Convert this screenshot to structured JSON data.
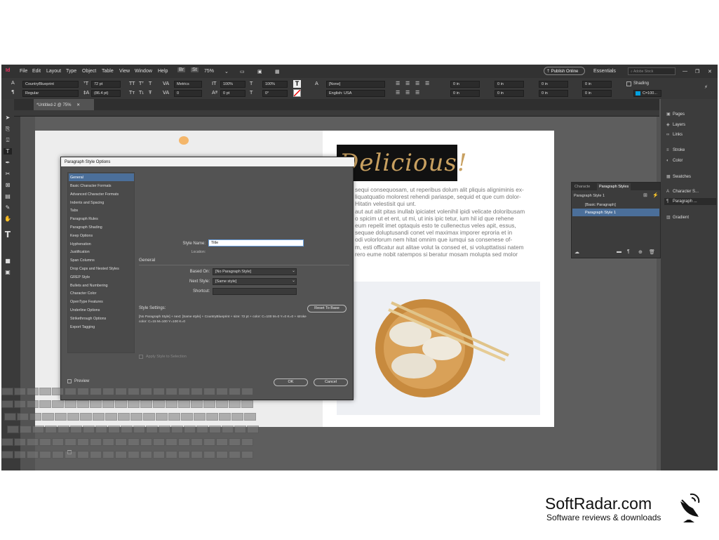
{
  "app": {
    "logo_text": "Id",
    "menu": [
      "File",
      "Edit",
      "Layout",
      "Type",
      "Object",
      "Table",
      "View",
      "Window",
      "Help"
    ],
    "bridge": "Br",
    "stock": "St",
    "zoom": "75%",
    "publish_label": "Publish Online",
    "workspace": "Essentials",
    "search_placeholder": "Adobe Stock"
  },
  "control_panel": {
    "font_family": "CountryBlueprint",
    "font_style": "Regular",
    "font_size": "72 pt",
    "leading": "(86.4 pt)",
    "kerning": "Metrics",
    "tracking": "0",
    "v_scale": "100%",
    "h_scale": "100%",
    "baseline": "0 pt",
    "skew": "0°",
    "char_style": "[None]",
    "language": "English: USA",
    "indent_values": [
      "0 in",
      "0 in",
      "0 in",
      "0 in",
      "0 in",
      "0 in",
      "0 in",
      "0 in"
    ],
    "shading_label": "Shading",
    "swatch_label": "C=100..."
  },
  "document": {
    "tab_label": "*Untitled-2 @ 75%",
    "headline": "Delicious!",
    "body_text": [
      "sequi consequosam, ut reperibus dolum alit pliquis aligniminis ex-",
      "liquatquatio molorest rehendi pariaspe, sequid et que cum dolor-",
      "Hitatin velestisit qui unt.",
      "aut aut alit pitas inullab ipiciatet volenihil ipidi velicate doloribusam",
      "o spicim ut et ent, ut mi, ut inis ipic tetur, ium hil id que rehene",
      "eum repelit imet optaquis esto te cullenectus veles apit, essus,",
      "sequae doluptusandi conet vel maximax imporer eproria et in",
      "odi volorlorum nem hitat omnim que iumqui sa consenese of-",
      "m, esti officatur aut alitae volut la consed et, si volupttatissi natem",
      "rero eume nobit ratempos si beratur mosam molupta sed molor"
    ]
  },
  "right_panel": {
    "items": [
      {
        "label": "Pages",
        "icon": "pages-icon"
      },
      {
        "label": "Layers",
        "icon": "layers-icon"
      },
      {
        "label": "Links",
        "icon": "links-icon"
      },
      {
        "label": "Stroke",
        "icon": "stroke-icon"
      },
      {
        "label": "Color",
        "icon": "color-icon"
      },
      {
        "label": "Swatches",
        "icon": "swatches-icon"
      },
      {
        "label": "Character S...",
        "icon": "character-styles-icon"
      },
      {
        "label": "Paragraph ...",
        "icon": "paragraph-styles-icon"
      },
      {
        "label": "Gradient",
        "icon": "gradient-icon"
      }
    ]
  },
  "paragraph_styles_panel": {
    "tab_inactive": "Characte",
    "tab_active": "Paragraph Styles",
    "current": "Paragraph Style 1",
    "items": [
      "[Basic Paragraph]",
      "Paragraph Style 1"
    ]
  },
  "dialog": {
    "title": "Paragraph Style Options",
    "categories": [
      "General",
      "Basic Character Formats",
      "Advanced Character Formats",
      "Indents and Spacing",
      "Tabs",
      "Paragraph Rules",
      "Paragraph Shading",
      "Keep Options",
      "Hyphenation",
      "Justification",
      "Span Columns",
      "Drop Caps and Nested Styles",
      "GREP Style",
      "Bullets and Numbering",
      "Character Color",
      "OpenType Features",
      "Underline Options",
      "Strikethrough Options",
      "Export Tagging"
    ],
    "style_name_label": "Style Name:",
    "style_name_value": "Title",
    "location_label": "Location:",
    "section_general": "General",
    "based_on_label": "Based On:",
    "based_on_value": "[No Paragraph Style]",
    "next_style_label": "Next Style:",
    "next_style_value": "[Same style]",
    "shortcut_label": "Shortcut:",
    "style_settings_label": "Style Settings:",
    "reset_button": "Reset To Base",
    "settings_text_1": "[No Paragraph Style] + next: [Same style] + CountryBlueprint + size: 72 pt + color: C=100 M=0 Y=0 K=0 + stroke",
    "settings_text_2": "color: C=15 M=100 Y=100 K=0",
    "apply_label": "Apply Style to Selection",
    "preview_label": "Preview",
    "ok_label": "OK",
    "cancel_label": "Cancel"
  },
  "footer": {
    "brand": "SoftRadar.com",
    "tagline": "Software reviews & downloads"
  },
  "colors": {
    "accent": "#4b6f9a",
    "logo": "#ff3366",
    "headline_bg": "#111111",
    "headline_text": "#c8a060"
  }
}
